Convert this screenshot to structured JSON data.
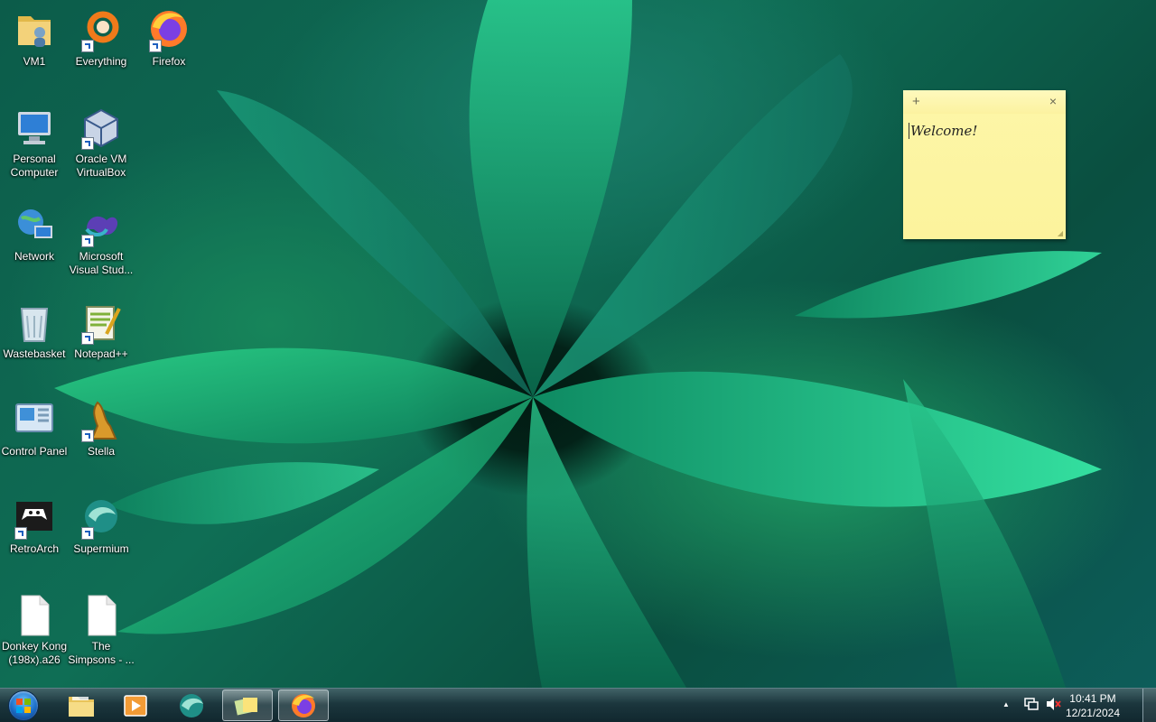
{
  "desktop_icons": [
    {
      "label": "VM1",
      "icon": "folder-user-icon"
    },
    {
      "label": "Everything",
      "icon": "everything-search-icon"
    },
    {
      "label": "Firefox",
      "icon": "firefox-icon"
    },
    {
      "label": "Personal Computer",
      "icon": "computer-icon"
    },
    {
      "label": "Oracle VM VirtualBox",
      "icon": "virtualbox-icon"
    },
    {
      "label": "Network",
      "icon": "network-icon"
    },
    {
      "label": "Microsoft Visual Stud...",
      "icon": "visual-studio-icon"
    },
    {
      "label": "Wastebasket",
      "icon": "recycle-bin-icon"
    },
    {
      "label": "Notepad++",
      "icon": "notepad-plus-plus-icon"
    },
    {
      "label": "Control Panel",
      "icon": "control-panel-icon"
    },
    {
      "label": "Stella",
      "icon": "stella-joystick-icon"
    },
    {
      "label": "RetroArch",
      "icon": "retroarch-icon"
    },
    {
      "label": "Supermium",
      "icon": "supermium-icon"
    },
    {
      "label": "Donkey Kong (198x).a26",
      "icon": "file-icon"
    },
    {
      "label": "The Simpsons - ...",
      "icon": "file-icon"
    }
  ],
  "sticky_note": {
    "add_glyph": "+",
    "close_glyph": "×",
    "text": "Welcome!"
  },
  "taskbar": {
    "buttons": [
      {
        "name": "start",
        "icon": "windows-orb-icon"
      },
      {
        "name": "file-explorer",
        "icon": "folder-icon"
      },
      {
        "name": "media-player",
        "icon": "media-player-icon"
      },
      {
        "name": "supermium",
        "icon": "supermium-icon"
      },
      {
        "name": "sticky-notes",
        "icon": "sticky-notes-icon",
        "active": true
      },
      {
        "name": "firefox",
        "icon": "firefox-icon",
        "active": true
      }
    ],
    "tray": {
      "overflow_glyph": "▲",
      "time": "10:41 PM",
      "date": "12/21/2024"
    }
  },
  "colors": {
    "sticky_yellow": "#fcf39c",
    "taskbar_dark": "#14303a"
  }
}
